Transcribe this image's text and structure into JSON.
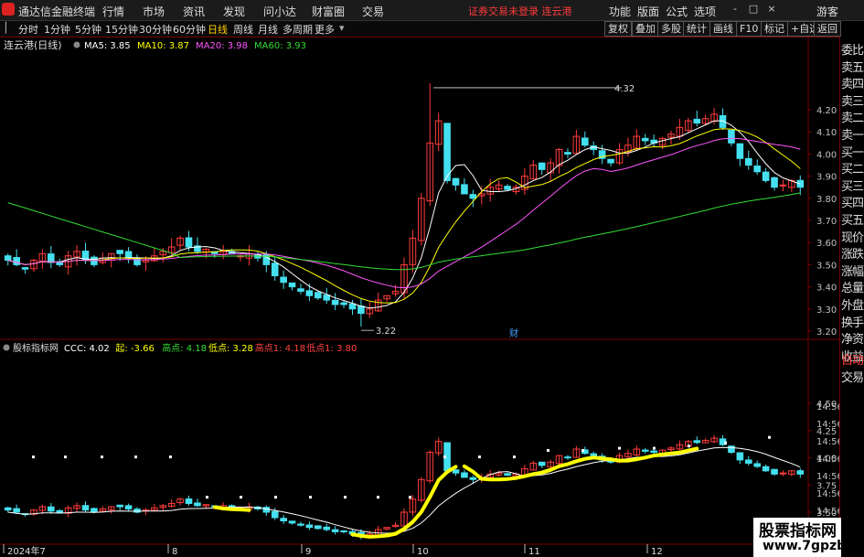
{
  "app": {
    "title": "通达信金融终端",
    "menus": [
      "行情",
      "市场",
      "资讯",
      "发现",
      "问小达",
      "财富圈",
      "交易"
    ],
    "notice": "证券交易未登录 连云港",
    "right_menus": [
      "功能",
      "版面",
      "公式",
      "选项"
    ],
    "guest": "游客",
    "win_buttons": [
      "-",
      "□",
      "×"
    ]
  },
  "toolbar": {
    "periods": [
      "分时",
      "1分钟",
      "5分钟",
      "15分钟",
      "30分钟",
      "60分钟",
      "日线",
      "周线",
      "月线",
      "多周期",
      "更多"
    ],
    "active_period": "日线",
    "right_buttons": [
      "复权",
      "叠加",
      "多股",
      "统计",
      "画线",
      "F10",
      "标记",
      "+自选",
      "返回"
    ]
  },
  "right_panel": {
    "items": [
      "委比",
      "卖五",
      "卖四",
      "卖三",
      "卖二",
      "卖一",
      "买一",
      "买二",
      "买三",
      "买四",
      "买五",
      "现价",
      "涨跌",
      "涨幅",
      "总量",
      "外盘",
      "换手",
      "净资",
      "收益",
      "自动",
      "交易"
    ],
    "red_items": [
      "自动"
    ]
  },
  "main_chart": {
    "stock": "连云港(日线)",
    "ma": [
      {
        "label": "MA5: 3.85",
        "color": "#ffffff"
      },
      {
        "label": "MA10: 3.87",
        "color": "#ffff00"
      },
      {
        "label": "MA20: 3.98",
        "color": "#ff55ff"
      },
      {
        "label": "MA60: 3.93",
        "color": "#33dd33"
      }
    ],
    "annotations": [
      "4.32",
      "3.22",
      "财"
    ]
  },
  "indicator": {
    "name": "股标指标网",
    "values": [
      {
        "label": "CCC: 4.02",
        "color": "#ffffff"
      },
      {
        "label": "起: -3.66",
        "color": "#ffff00"
      },
      {
        "label": "高点: 4.18",
        "color": "#33dd33"
      },
      {
        "label": "低点: 3.28",
        "color": "#ffff00"
      },
      {
        "label": "高点1: 4.18",
        "color": "#ff4040"
      },
      {
        "label": "低点1: 3.80",
        "color": "#ff4040"
      }
    ]
  },
  "watermark": {
    "line1": "股票指标网",
    "line2": "www.7gpzb.com"
  },
  "chart_data": [
    {
      "type": "candlestick",
      "title": "连云港(日线)",
      "y_ticks": [
        4.2,
        4.1,
        4.0,
        3.9,
        3.8,
        3.7,
        3.6,
        3.5,
        3.4,
        3.3,
        3.2
      ],
      "x_labels": [
        "2024年7",
        "8",
        "9",
        "10",
        "11",
        "12"
      ],
      "high_label": 4.32,
      "low_label": 3.22,
      "close_series": [
        3.52,
        3.5,
        3.48,
        3.52,
        3.55,
        3.51,
        3.5,
        3.54,
        3.56,
        3.52,
        3.5,
        3.53,
        3.55,
        3.55,
        3.53,
        3.5,
        3.52,
        3.54,
        3.56,
        3.58,
        3.62,
        3.58,
        3.56,
        3.57,
        3.55,
        3.56,
        3.55,
        3.54,
        3.55,
        3.53,
        3.5,
        3.45,
        3.42,
        3.4,
        3.38,
        3.36,
        3.35,
        3.34,
        3.32,
        3.32,
        3.3,
        3.28,
        3.3,
        3.34,
        3.36,
        3.38,
        3.5,
        3.62,
        3.8,
        4.05,
        4.15,
        3.88,
        3.86,
        3.82,
        3.8,
        3.82,
        3.85,
        3.86,
        3.84,
        3.85,
        3.9,
        3.95,
        3.93,
        3.96,
        4.02,
        4.0,
        4.08,
        4.04,
        4.02,
        3.98,
        3.96,
        4.02,
        4.04,
        4.08,
        4.06,
        4.05,
        4.07,
        4.09,
        4.12,
        4.15,
        4.14,
        4.16,
        4.18,
        4.12,
        4.05,
        3.98,
        3.95,
        3.92,
        3.88,
        3.85,
        3.86,
        3.88,
        3.85
      ],
      "ma": {
        "MA5": 3.85,
        "MA10": 3.87,
        "MA20": 3.98,
        "MA60": 3.93
      }
    },
    {
      "type": "line",
      "title": "股标指标网",
      "y_ticks": [
        4.5,
        4.25,
        4.0,
        3.75,
        3.5
      ],
      "series": [
        {
          "name": "CCC",
          "value": 4.02
        },
        {
          "name": "高点",
          "value": 4.18
        },
        {
          "name": "低点",
          "value": 3.28
        },
        {
          "name": "高点1",
          "value": 4.18
        },
        {
          "name": "低点1",
          "value": 3.8
        }
      ]
    }
  ],
  "colors": {
    "up": "#ff3b3b",
    "down": "#44e0f0",
    "grid": "#7a0000",
    "axis_text": "#c0c0c0",
    "ma5": "#ffffff",
    "ma10": "#ffff00",
    "ma20": "#ff55ff",
    "ma60": "#33dd33"
  }
}
